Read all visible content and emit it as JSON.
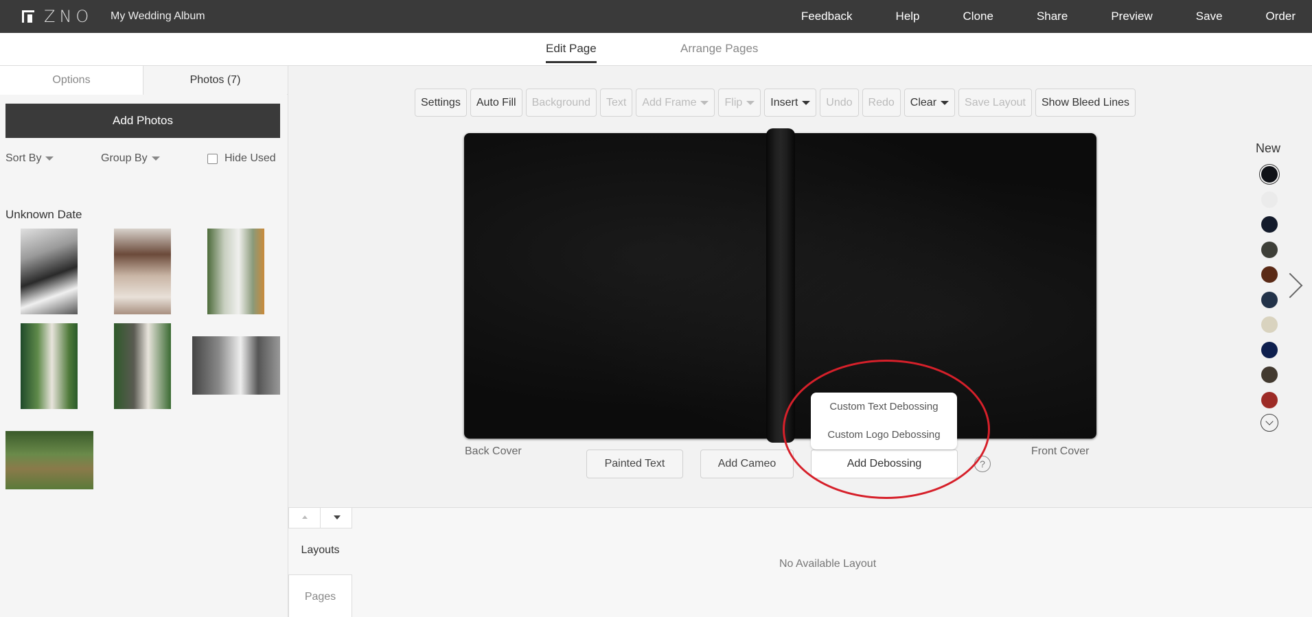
{
  "app": {
    "logo_text": "ZNO",
    "album_title": "My Wedding Album"
  },
  "topnav": [
    "Feedback",
    "Help",
    "Clone",
    "Share",
    "Preview",
    "Save",
    "Order"
  ],
  "subtabs": {
    "active": "Edit Page",
    "inactive": "Arrange Pages"
  },
  "left_panel": {
    "tabs": {
      "options": "Options",
      "photos": "Photos (7)"
    },
    "add_photos": "Add Photos",
    "sort_by": "Sort By",
    "group_by": "Group By",
    "hide_used": "Hide Used",
    "date_header": "Unknown Date"
  },
  "toolbar": [
    {
      "label": "Settings",
      "enabled": true
    },
    {
      "label": "Auto Fill",
      "enabled": true
    },
    {
      "label": "Background",
      "enabled": false
    },
    {
      "label": "Text",
      "enabled": false
    },
    {
      "label": "Add Frame",
      "enabled": false
    },
    {
      "label": "Flip",
      "enabled": false
    },
    {
      "label": "Insert",
      "enabled": true
    },
    {
      "label": "Undo",
      "enabled": false
    },
    {
      "label": "Redo",
      "enabled": false
    },
    {
      "label": "Clear",
      "enabled": true
    },
    {
      "label": "Save Layout",
      "enabled": false
    },
    {
      "label": "Show Bleed Lines",
      "enabled": true
    }
  ],
  "cover": {
    "back_label": "Back Cover",
    "front_label": "Front Cover",
    "buttons": {
      "painted_text": "Painted Text",
      "add_cameo": "Add Cameo",
      "add_debossing": "Add Debossing"
    },
    "help": "?",
    "debossing_menu": [
      "Custom Text Debossing",
      "Custom Logo Debossing"
    ]
  },
  "colors": {
    "label": "New",
    "swatches": [
      "#101217",
      "#ebebeb",
      "#141b2b",
      "#3e3f38",
      "#5a2a16",
      "#233349",
      "#d9d3bf",
      "#0e1f4e",
      "#433a30",
      "#9d2b26"
    ],
    "selected_index": 0
  },
  "bottom": {
    "layouts": "Layouts",
    "pages": "Pages",
    "no_layout": "No Available Layout"
  }
}
